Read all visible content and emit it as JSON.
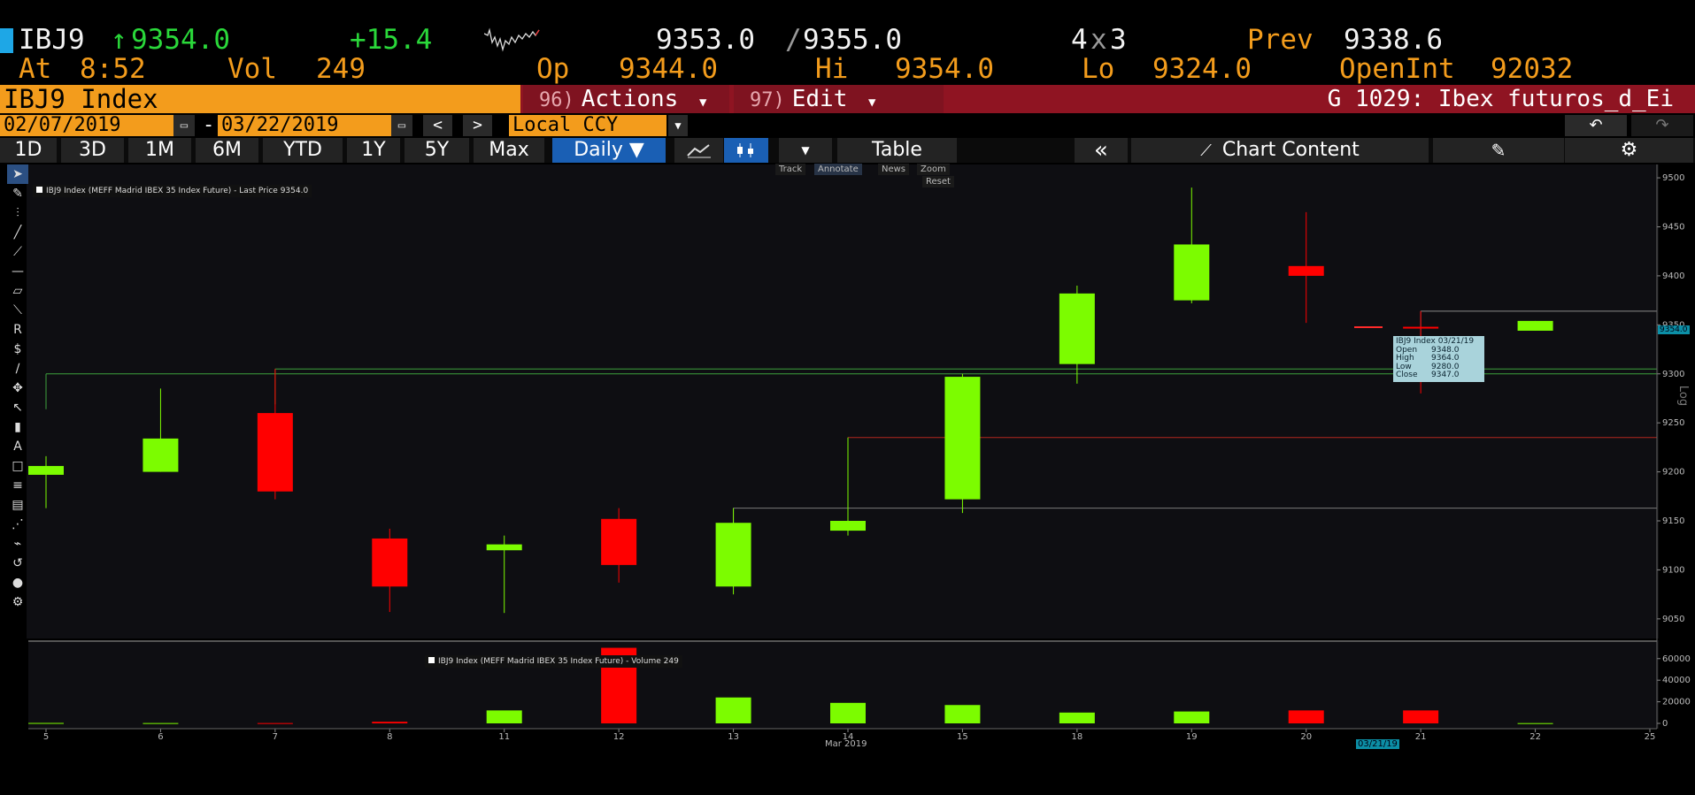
{
  "quote": {
    "ticker": "IBJ9",
    "arrow": "↑",
    "last": "9354.0",
    "change": "+15.4",
    "bid_ask_bid": "9353.0",
    "bid_ask_sep": "/",
    "bid_ask_ask": "9355.0",
    "size_a": "4",
    "size_x": "x",
    "size_b": "3",
    "prev_label": "Prev",
    "prev": "9338.6",
    "at_label": "At",
    "at_time": "8:52",
    "vol_label": "Vol",
    "vol": "249",
    "op_label": "Op",
    "op": "9344.0",
    "hi_label": "Hi",
    "hi": "9354.0",
    "lo_label": "Lo",
    "lo": "9324.0",
    "oi_label": "OpenInt",
    "oi": "92032"
  },
  "security_bar": {
    "title": "IBJ9 Index",
    "actions_num": "96)",
    "actions_label": "Actions",
    "edit_num": "97)",
    "edit_label": "Edit",
    "page_title": "G 1029: Ibex futuros_d_Ei"
  },
  "range_bar": {
    "start_date": "02/07/2019",
    "dash": "-",
    "end_date": "03/22/2019",
    "prev_label": "<",
    "next_label": ">",
    "currency": "Local CCY"
  },
  "tabs": [
    {
      "label": "1D"
    },
    {
      "label": "3D"
    },
    {
      "label": "1M"
    },
    {
      "label": "6M"
    },
    {
      "label": "YTD"
    },
    {
      "label": "1Y"
    },
    {
      "label": "5Y"
    },
    {
      "label": "Max"
    }
  ],
  "frequency": "Daily ▼",
  "table_label": "Table",
  "collapse_label": "«",
  "chart_content_label": "Chart Content",
  "chart_controls": {
    "track": "Track",
    "annotate": "Annotate",
    "news": "News",
    "zoom": "Zoom",
    "reset": "Reset"
  },
  "legend_price": "IBJ9 Index (MEFF Madrid IBEX 35 Index Future) - Last Price 9354.0",
  "legend_volume": "IBJ9 Index (MEFF Madrid IBEX 35 Index Future) - Volume 249",
  "tooltip": {
    "title": "IBJ9 Index 03/21/19",
    "rows": [
      {
        "k": "Open",
        "v": "9348.0"
      },
      {
        "k": "High",
        "v": "9364.0"
      },
      {
        "k": "Low",
        "v": "9280.0"
      },
      {
        "k": "Close",
        "v": "9347.0"
      }
    ]
  },
  "log_label": "Log",
  "price_marker": "9354.0",
  "colors": {
    "up": "#7cfc00",
    "down": "#ff0000",
    "accent": "#f39c1c",
    "bar_red": "#8f1422"
  },
  "chart_data": {
    "type": "candlestick",
    "x": [
      "5",
      "6",
      "7",
      "8",
      "11",
      "12",
      "13",
      "14",
      "15",
      "18",
      "19",
      "20",
      "21",
      "22",
      "25"
    ],
    "month_label": "Mar 2019",
    "cursor_date": "03/21/19",
    "candles": [
      {
        "d": "5",
        "o": 9197,
        "h": 9216,
        "l": 9163,
        "c": 9206
      },
      {
        "d": "6",
        "o": 9200,
        "h": 9285,
        "l": 9200,
        "c": 9234
      },
      {
        "d": "7",
        "o": 9260,
        "h": 9305,
        "l": 9172,
        "c": 9180
      },
      {
        "d": "8",
        "o": 9132,
        "h": 9142,
        "l": 9057,
        "c": 9083
      },
      {
        "d": "11",
        "o": 9120,
        "h": 9135,
        "l": 9056,
        "c": 9126
      },
      {
        "d": "12",
        "o": 9152,
        "h": 9163,
        "l": 9087,
        "c": 9105
      },
      {
        "d": "13",
        "o": 9083,
        "h": 9163,
        "l": 9075,
        "c": 9148
      },
      {
        "d": "14",
        "o": 9140,
        "h": 9235,
        "l": 9135,
        "c": 9150
      },
      {
        "d": "15",
        "o": 9172,
        "h": 9300,
        "l": 9158,
        "c": 9297
      },
      {
        "d": "18",
        "o": 9310,
        "h": 9390,
        "l": 9290,
        "c": 9382
      },
      {
        "d": "19",
        "o": 9375,
        "h": 9490,
        "l": 9372,
        "c": 9432
      },
      {
        "d": "20",
        "o": 9410,
        "h": 9465,
        "l": 9352,
        "c": 9400
      },
      {
        "d": "21",
        "o": 9348,
        "h": 9364,
        "l": 9280,
        "c": 9347
      },
      {
        "d": "22",
        "o": 9344,
        "h": 9354,
        "l": 9344,
        "c": 9354
      }
    ],
    "volume": [
      {
        "d": "5",
        "v": 400,
        "up": true
      },
      {
        "d": "6",
        "v": 300,
        "up": true
      },
      {
        "d": "7",
        "v": 300,
        "up": false
      },
      {
        "d": "8",
        "v": 1500,
        "up": false
      },
      {
        "d": "11",
        "v": 12000,
        "up": true
      },
      {
        "d": "12",
        "v": 70000,
        "up": false
      },
      {
        "d": "13",
        "v": 24000,
        "up": true
      },
      {
        "d": "14",
        "v": 19000,
        "up": true
      },
      {
        "d": "15",
        "v": 17000,
        "up": true
      },
      {
        "d": "18",
        "v": 10000,
        "up": true
      },
      {
        "d": "19",
        "v": 11000,
        "up": true
      },
      {
        "d": "20",
        "v": 12000,
        "up": false
      },
      {
        "d": "21",
        "v": 12000,
        "up": false
      },
      {
        "d": "22",
        "v": 249,
        "up": true
      }
    ],
    "y_ticks": [
      "9500",
      "9450",
      "9400",
      "9350",
      "9300",
      "9250",
      "9200",
      "9150",
      "9100",
      "9050"
    ],
    "y_range": [
      9030,
      9510
    ],
    "vol_ticks": [
      "60000",
      "40000",
      "20000",
      "0"
    ],
    "vol_range": [
      0,
      68000
    ],
    "h_levels": [
      {
        "v": 9305,
        "color": "#3da13d"
      },
      {
        "v": 9300,
        "color": "#3da13d"
      },
      {
        "v": 9235,
        "color": "#b3261e"
      },
      {
        "v": 9163,
        "color": "#7a7a7a"
      },
      {
        "v": 9364,
        "color": "#8a8a8a"
      }
    ]
  }
}
